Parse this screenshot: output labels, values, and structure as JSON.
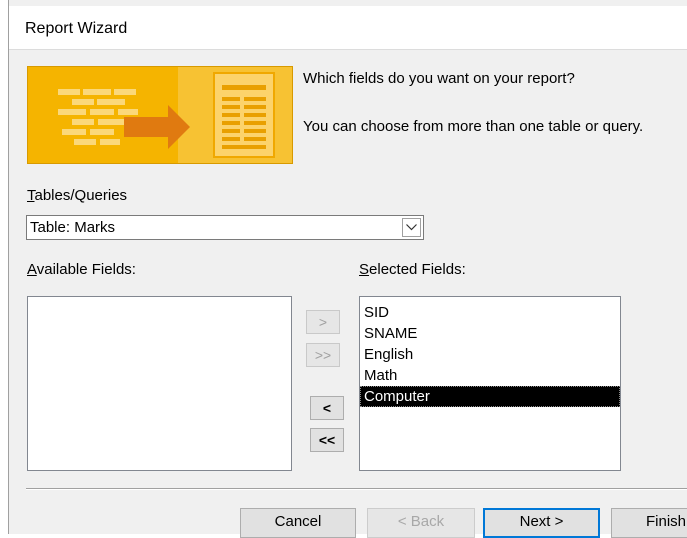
{
  "window": {
    "title": "Report Wizard"
  },
  "intro": {
    "question": "Which fields do you want on your report?",
    "hint": "You can choose from more than one table or query."
  },
  "tables_queries": {
    "label_prefix": "T",
    "label_rest": "ables/Queries",
    "selected": "Table: Marks"
  },
  "available": {
    "label_prefix": "A",
    "label_rest": "vailable Fields:",
    "items": []
  },
  "selected_fields": {
    "label_prefix": "S",
    "label_rest": "elected Fields:",
    "items": [
      "SID",
      "SNAME",
      "English",
      "Math",
      "Computer"
    ],
    "highlighted": "Computer"
  },
  "move_buttons": {
    "add_one": ">",
    "add_all": ">>",
    "remove_one": "<",
    "remove_all": "<<"
  },
  "buttons": {
    "cancel": "Cancel",
    "back": "< Back",
    "next": "Next >",
    "finish": "Finish"
  },
  "colors": {
    "banner": "#f5b400",
    "selection": "#000000",
    "default_border": "#0078d7"
  }
}
